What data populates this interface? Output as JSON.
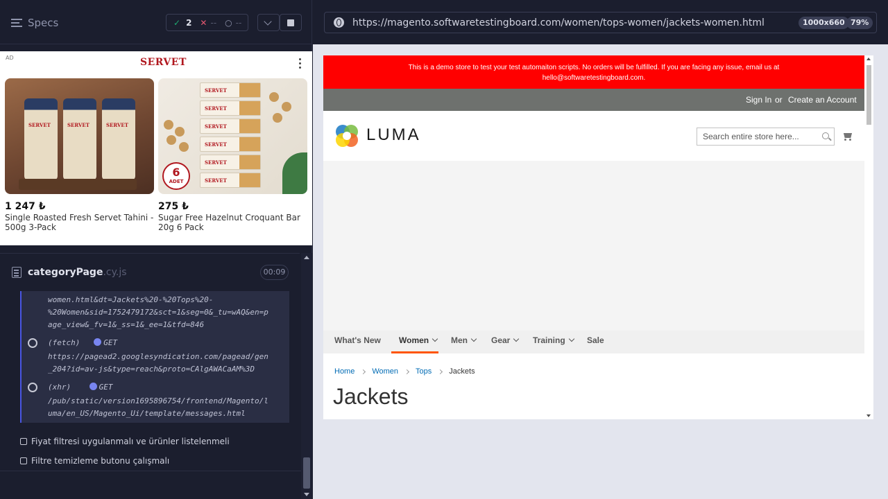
{
  "reporter": {
    "specs_label": "Specs",
    "stats": {
      "passed": "2",
      "failed": "--",
      "pending": "--"
    }
  },
  "ad": {
    "tag": "AD",
    "brand": "SERVET",
    "products": [
      {
        "price": "1 247 ₺",
        "name": "Single Roasted Fresh Servet Tahini - 500g 3-Pack"
      },
      {
        "price": "275 ₺",
        "name": "Sugar Free Hazelnut Croquant Bar 20g 6 Pack"
      }
    ],
    "badge_number": "6",
    "badge_text": "ADET"
  },
  "spec": {
    "file_name": "categoryPage",
    "file_ext": ".cy.js",
    "timer": "00:09",
    "log_lines": [
      "women.html&dt=Jackets%20-%20Tops%20-",
      "%20Women&sid=1752479172&sct=1&seg=0&_tu=wAQ&en=p",
      "age_view&_fv=1&_ss=1&_ee=1&tfd=846"
    ],
    "requests": [
      {
        "type": "(fetch)",
        "method": "GET",
        "url_lines": [
          "https://pagead2.googlesyndication.com/pagead/gen",
          "_204?id=av-js&type=reach&proto=CAlgAWACaAM%3D"
        ]
      },
      {
        "type": "(xhr)",
        "method": "GET",
        "url_lines": [
          "/pub/static/version1695896754/frontend/Magento/l",
          "uma/en_US/Magento_Ui/template/messages.html"
        ]
      }
    ],
    "pending_tests": [
      "Fiyat filtresi uygulanmalı ve ürünler listelenmeli",
      "Filtre temizleme butonu çalışmalı"
    ]
  },
  "browser": {
    "url": "https://magento.softwaretestingboard.com/women/tops-women/jackets-women.html",
    "viewport": "1000x660",
    "zoom": "79%"
  },
  "site": {
    "notice_line1": "This is a demo store to test your test automaiton scripts. No orders will be fulfilled. If you are facing any issue, email us at",
    "notice_line2": "hello@softwaretestingboard.com.",
    "sign_in": "Sign In",
    "or": "or",
    "create_account": "Create an Account",
    "logo_text": "LUMA",
    "search_placeholder": "Search entire store here...",
    "nav": [
      "What's New",
      "Women",
      "Men",
      "Gear",
      "Training",
      "Sale"
    ],
    "breadcrumbs": [
      "Home",
      "Women",
      "Tops",
      "Jackets"
    ],
    "page_title": "Jackets"
  },
  "colors": {
    "passed": "#1fa971",
    "failed": "#e45770",
    "notice_bg": "#ff0000",
    "nav_active_underline": "#ff5501",
    "link": "#006bb4"
  }
}
